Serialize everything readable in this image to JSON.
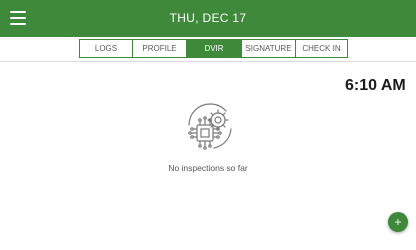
{
  "header": {
    "date": "THU, DEC  17",
    "menu_icon": "hamburger-icon",
    "theme_icon": "moon-icon"
  },
  "tabs": [
    {
      "label": "LOGS",
      "active": false
    },
    {
      "label": "PROFILE",
      "active": false
    },
    {
      "label": "DVIR",
      "active": true
    },
    {
      "label": "SIGNATURE",
      "active": false
    },
    {
      "label": "CHECK IN",
      "active": false
    }
  ],
  "clock": "6:10 AM",
  "empty_state": {
    "icon": "gear-chip-icon",
    "message": "No inspections so far"
  },
  "fab": {
    "label": "+",
    "icon": "add-icon"
  },
  "colors": {
    "brand": "#3f8a3a",
    "text": "#555555"
  }
}
